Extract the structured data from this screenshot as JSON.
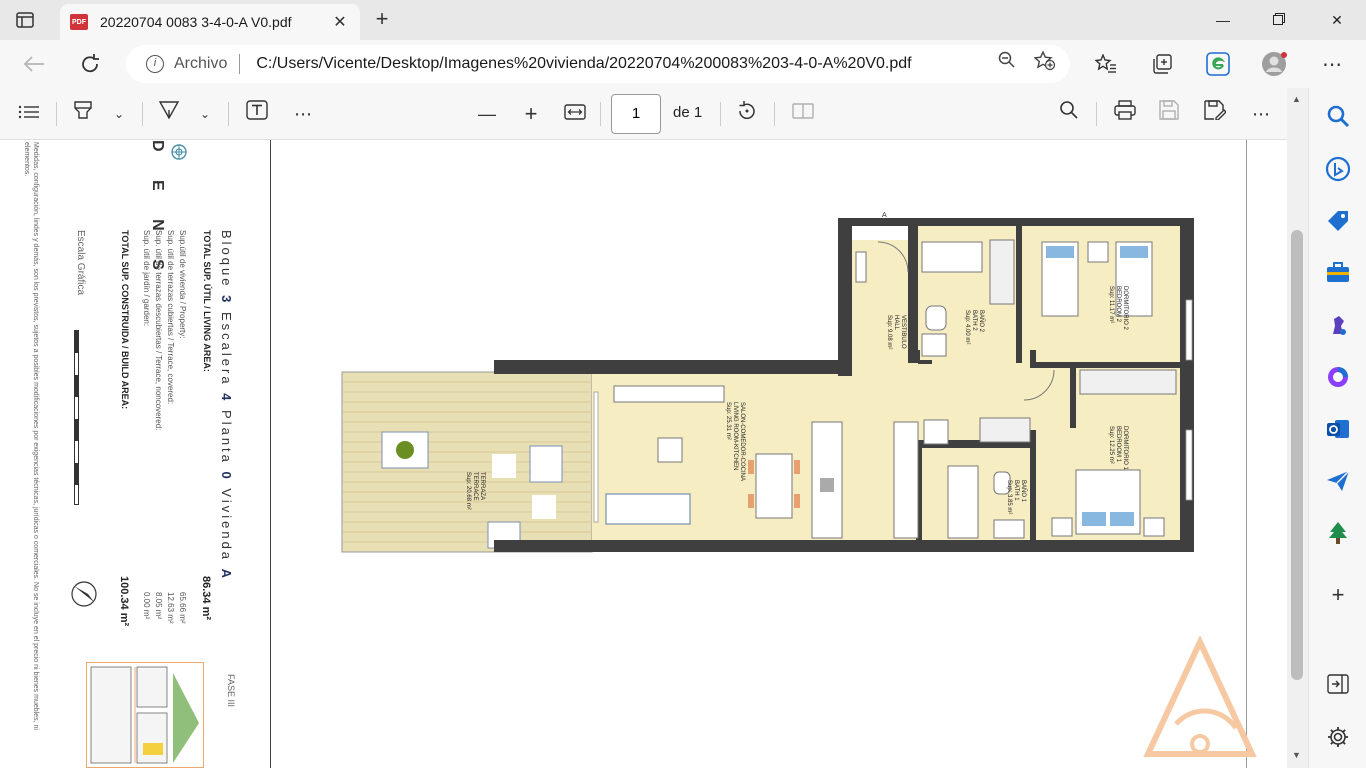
{
  "browser": {
    "tab_title": "20220704 0083 3-4-0-A V0.pdf",
    "tab_badge": "PDF",
    "new_tab": "+",
    "address_label": "Archivo",
    "url": "C:/Users/Vicente/Desktop/Imagenes%20vivienda/20220704%200083%203-4-0-A%20V0.pdf"
  },
  "pdf_toolbar": {
    "page_number": "1",
    "page_of": "de 1"
  },
  "plan": {
    "project_name": "D E N S",
    "block_line": "Bloque 3 Escalera 4 Planta 0 Vivienda A",
    "block_label": "Bloque",
    "block_value": "3",
    "stair_label": "Escalera",
    "stair_value": "4",
    "floor_label": "Planta",
    "floor_value": "0",
    "unit_label": "Vivienda",
    "unit_value": "A",
    "total_useful_label": "TOTAL SUP. ÚTIL / LIVING AREA:",
    "total_useful_value": "86.34 m²",
    "rows": [
      {
        "label": "Sup.útil de vivienda / Property:",
        "value": "65.66 m²"
      },
      {
        "label": "Sup. útil de terrazas cubiertas / Terrace, covered:",
        "value": "12.63 m²"
      },
      {
        "label": "Sup. útil de terrazas descubiertas / Terrace, noncovered:",
        "value": "8.05 m²"
      },
      {
        "label": "Sup. útil de jardín / garden:",
        "value": "0.00 m²"
      }
    ],
    "total_built_label": "TOTAL SUP. CONSTRUIDA / BUILD AREA:",
    "total_built_value": "100.34 m²",
    "scale_label": "Escala Gráfica",
    "phase": "FASE III",
    "disclaimer": "Medidas, configuración, lindes y demás, son los previstos, sujetos a posibles modificaciones por exigencias técnicas, jurídicas o comerciales. No se incluye en el precio ni bienes muebles, ni elementos.",
    "rooms": [
      {
        "name": "TERRAZA",
        "name_en": "TERRACE",
        "area": "Sup: 20.68 m²"
      },
      {
        "name": "SALON-COMEDOR-COCINA",
        "name_en": "LIVING ROOM-KITCHEN",
        "area": "Sup: 25.31 m²"
      },
      {
        "name": "VESTIBULO",
        "name_en": "HALL",
        "area": "Sup: 9.08 m²"
      },
      {
        "name": "BAÑO 2",
        "name_en": "BATH 2",
        "area": "Sup: 4.00 m²"
      },
      {
        "name": "DORMITORIO 2",
        "name_en": "BEDROOM 2",
        "area": "Sup: 11.17 m²"
      },
      {
        "name": "DORMITORIO 1",
        "name_en": "BEDROOM 1",
        "area": "Sup: 12.25 m²"
      },
      {
        "name": "BAÑO 1",
        "name_en": "BATH 1",
        "area": "Sup: 3.85 m²"
      }
    ],
    "section_mark": "A"
  },
  "colors": {
    "floor": "#f6edc3",
    "wall": "#3f3f3f",
    "terrace_deck": "#e9dfb4",
    "accent_blue": "#23325f",
    "watermark": "#f0a86a"
  }
}
